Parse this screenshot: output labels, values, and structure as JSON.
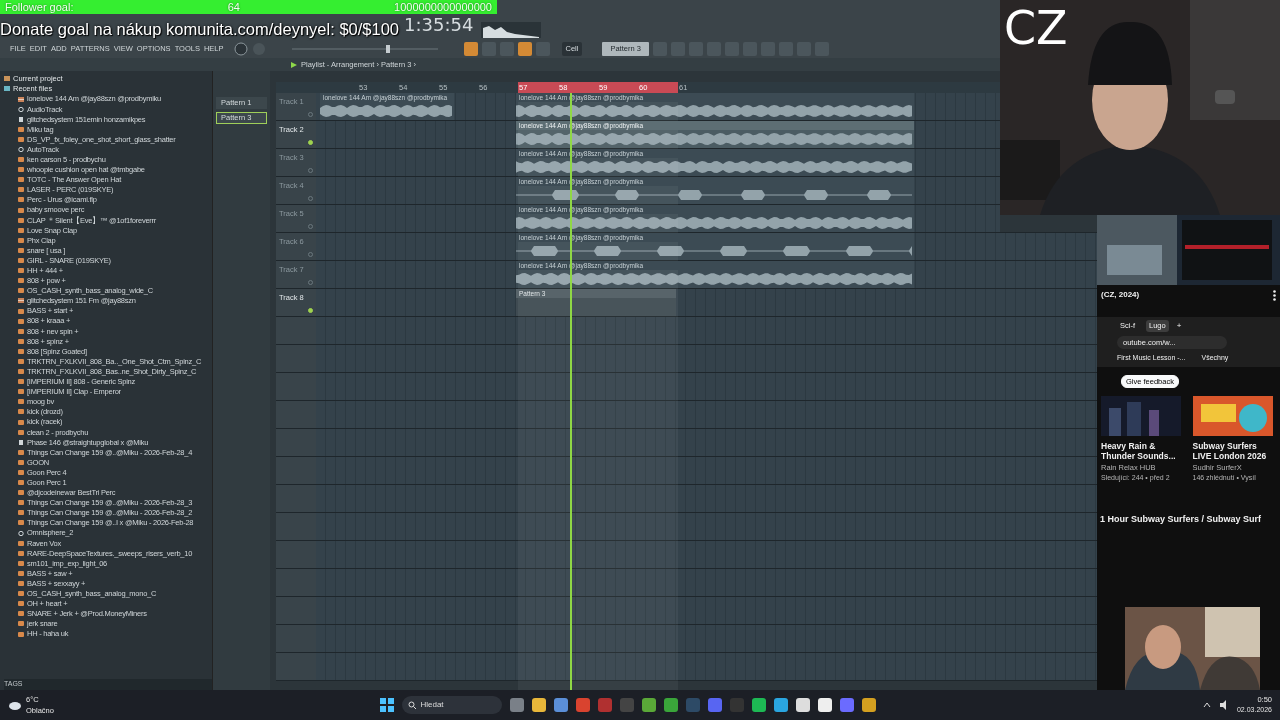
{
  "stream_overlay": {
    "follower_goal": {
      "label": "Follower goal:",
      "current": "64",
      "target": "1000000000000000"
    },
    "donate_goal": "Donate goal na nákup komunita.com/deynyel: $0/$100",
    "badge": "CZ"
  },
  "fl_studio": {
    "clock": "1:35:54",
    "menu": [
      "FILE",
      "EDIT",
      "ADD",
      "PATTERNS",
      "VIEW",
      "OPTIONS",
      "TOOLS",
      "HELP"
    ],
    "snap": "Cell",
    "pattern_selector": "Pattern 3",
    "playlist_title": "Playlist - Arrangement › Pattern 3 ›",
    "browser": {
      "sections": [
        {
          "label": "Current project",
          "kind": "project"
        },
        {
          "label": "Recent files",
          "kind": "recent"
        }
      ],
      "files": [
        {
          "name": "lonelove 144 Am @jay88szn @prodbymiku",
          "kind": "project"
        },
        {
          "name": "AudioTrack",
          "kind": "plugin"
        },
        {
          "name": "glitchedsystem 151emin honzamikpes",
          "kind": "file"
        },
        {
          "name": "Miku tag",
          "kind": "audio"
        },
        {
          "name": "DS_VP_fx_foley_one_shot_short_glass_shatter",
          "kind": "audio"
        },
        {
          "name": "AutoTrack",
          "kind": "plugin"
        },
        {
          "name": "ken carson 5 - prodbychu",
          "kind": "audio"
        },
        {
          "name": "whoopie cushion open hat @tmbgabe",
          "kind": "audio"
        },
        {
          "name": "TOTC - The Answer Open Hat",
          "kind": "audio"
        },
        {
          "name": "LASER - PERC (019SKYE)",
          "kind": "audio"
        },
        {
          "name": "Perc - Urus @icami.flp",
          "kind": "audio"
        },
        {
          "name": "baby smoove perc",
          "kind": "audio"
        },
        {
          "name": "CLAP ＊Silent【Eve】™ @1of1foreverrr",
          "kind": "audio"
        },
        {
          "name": "Love Snap Clap",
          "kind": "audio"
        },
        {
          "name": "Phx Clap",
          "kind": "audio"
        },
        {
          "name": "snare [ usa ]",
          "kind": "audio"
        },
        {
          "name": "GIRL - SNARE (019SKYE)",
          "kind": "audio"
        },
        {
          "name": "HH + 444 +",
          "kind": "audio"
        },
        {
          "name": "808 + pow +",
          "kind": "audio"
        },
        {
          "name": "OS_CASH_synth_bass_analog_wide_C",
          "kind": "audio"
        },
        {
          "name": "glitchedsystem 151 Fm @jay88szn",
          "kind": "project"
        },
        {
          "name": "BASS + start +",
          "kind": "audio"
        },
        {
          "name": "808 + kraaa +",
          "kind": "audio"
        },
        {
          "name": "808 + nev spin +",
          "kind": "audio"
        },
        {
          "name": "808 + spinz +",
          "kind": "audio"
        },
        {
          "name": "808 [Spinz Goated]",
          "kind": "audio"
        },
        {
          "name": "TRKTRN_FXLKVII_808_Ba.._One_Shot_Ctm_Spinz_C",
          "kind": "audio"
        },
        {
          "name": "TRKTRN_FXLKVII_808_Bas..ne_Shot_Dirty_Spinz_C",
          "kind": "audio"
        },
        {
          "name": "[IMPERIUM II] 808 - Generic Spinz",
          "kind": "audio"
        },
        {
          "name": "[IMPERIUM II] Clap - Emperor",
          "kind": "audio"
        },
        {
          "name": "moog bv",
          "kind": "audio"
        },
        {
          "name": "kick (drozd)",
          "kind": "audio"
        },
        {
          "name": "kick (racek)",
          "kind": "audio"
        },
        {
          "name": "clean 2 - prodbychu",
          "kind": "audio"
        },
        {
          "name": "Phase 146 @straightupglobal x @Miku",
          "kind": "file"
        },
        {
          "name": "Things Can Change 159 @..@Miku - 2026-Feb-28_4",
          "kind": "audio"
        },
        {
          "name": "GOON",
          "kind": "audio"
        },
        {
          "name": "Goon Perc 4",
          "kind": "audio"
        },
        {
          "name": "Goon Perc 1",
          "kind": "audio"
        },
        {
          "name": "@djcodeinewar BestTri Perc",
          "kind": "audio"
        },
        {
          "name": "Things Can Change 159 @..@Miku - 2026-Feb-28_3",
          "kind": "audio"
        },
        {
          "name": "Things Can Change 159 @..@Miku - 2026-Feb-28_2",
          "kind": "audio"
        },
        {
          "name": "Things Can Change 159 @..I x @Miku - 2026-Feb-28",
          "kind": "audio"
        },
        {
          "name": "Omnisphere_2",
          "kind": "plugin"
        },
        {
          "name": "Raven Vox",
          "kind": "audio"
        },
        {
          "name": "RARE-DeepSpaceTextures._sweeps_risers_verb_10",
          "kind": "audio"
        },
        {
          "name": "sm101_imp_exp_light_06",
          "kind": "audio"
        },
        {
          "name": "BASS + saw +",
          "kind": "audio"
        },
        {
          "name": "BASS + sexxayy +",
          "kind": "audio"
        },
        {
          "name": "OS_CASH_synth_bass_analog_mono_C",
          "kind": "audio"
        },
        {
          "name": "OH + heart +",
          "kind": "audio"
        },
        {
          "name": "SNARE + Jerk + @Prod.MoneyMiners",
          "kind": "audio"
        },
        {
          "name": "jerk snare",
          "kind": "audio"
        },
        {
          "name": "HH - haha uk",
          "kind": "audio"
        }
      ],
      "tags_label": "TAGS"
    },
    "patterns": [
      {
        "label": "Pattern 1",
        "selected": false
      },
      {
        "label": "Pattern 3",
        "selected": true
      }
    ],
    "ruler": [
      {
        "label": "53",
        "loop": false
      },
      {
        "label": "54",
        "loop": false
      },
      {
        "label": "55",
        "loop": false
      },
      {
        "label": "56",
        "loop": false
      },
      {
        "label": "57",
        "loop": true
      },
      {
        "label": "58",
        "loop": true
      },
      {
        "label": "59",
        "loop": true
      },
      {
        "label": "60",
        "loop": true
      },
      {
        "label": "61",
        "loop": false
      }
    ],
    "tracks": [
      {
        "label": "Track 1",
        "dimmed": true,
        "clips": [
          {
            "kind": "audio",
            "label": "lonelove 144 Am @jay88szn @prodbymika",
            "selected": false
          },
          {
            "kind": "audio",
            "label": "lonelove 144 Am @jay88szn @prodbymika",
            "selected": false
          }
        ]
      },
      {
        "label": "Track 2",
        "dimmed": false,
        "clips": [
          {
            "kind": "audio",
            "label": "lonelove 144 Am @jay88szn @prodbymika",
            "selected": true
          }
        ]
      },
      {
        "label": "Track 3",
        "dimmed": true,
        "clips": [
          {
            "kind": "audio",
            "label": "lonelove 144 Am @jay88szn @prodbymika",
            "selected": false
          }
        ]
      },
      {
        "label": "Track 4",
        "dimmed": true,
        "clips": [
          {
            "kind": "audio",
            "label": "lonelove 144 Am @jay88szn @prodbymika",
            "selected": false
          }
        ]
      },
      {
        "label": "Track 5",
        "dimmed": true,
        "clips": [
          {
            "kind": "audio",
            "label": "lonelove 144 Am @jay88szn @prodbymika",
            "selected": false
          }
        ]
      },
      {
        "label": "Track 6",
        "dimmed": true,
        "clips": [
          {
            "kind": "audio",
            "label": "lonelove 144 Am @jay88szn @prodbymika",
            "selected": false
          }
        ]
      },
      {
        "label": "Track 7",
        "dimmed": true,
        "clips": [
          {
            "kind": "audio",
            "label": "lonelove 144 Am @jay88szn @prodbymika",
            "selected": false
          }
        ]
      },
      {
        "label": "Track 8",
        "dimmed": false,
        "clips": [
          {
            "kind": "pattern",
            "label": "Pattern 3",
            "selected": false
          }
        ]
      }
    ]
  },
  "youtube": {
    "top_video_meta": "(CZ, 2024)",
    "tabs": [
      {
        "label": "Sci-f",
        "selected": false
      },
      {
        "label": "Lugo",
        "selected": true
      }
    ],
    "new_tab": "+",
    "address": "outube.com/w...",
    "bookmarks": [
      "First Music Lesson -...",
      "Všechny"
    ],
    "feedback_button": "Give feedback",
    "videos": [
      {
        "title": "Heavy Rain & Thunder Sounds...",
        "channel": "Rain Relax HUB",
        "meta": "Sledující: 244 • před 2"
      },
      {
        "title": "Subway Surfers LIVE London 2026",
        "channel": "Sudhir SurferX",
        "meta": "146 zhlédnutí • Vysíl"
      }
    ],
    "playing_title": "1 Hour Subway Surfers / Subway Surf"
  },
  "taskbar": {
    "weather_temp": "6°C",
    "weather_text": "Oblačno",
    "search": "Hledat",
    "time": "0:50",
    "date": "02.03.2026"
  }
}
